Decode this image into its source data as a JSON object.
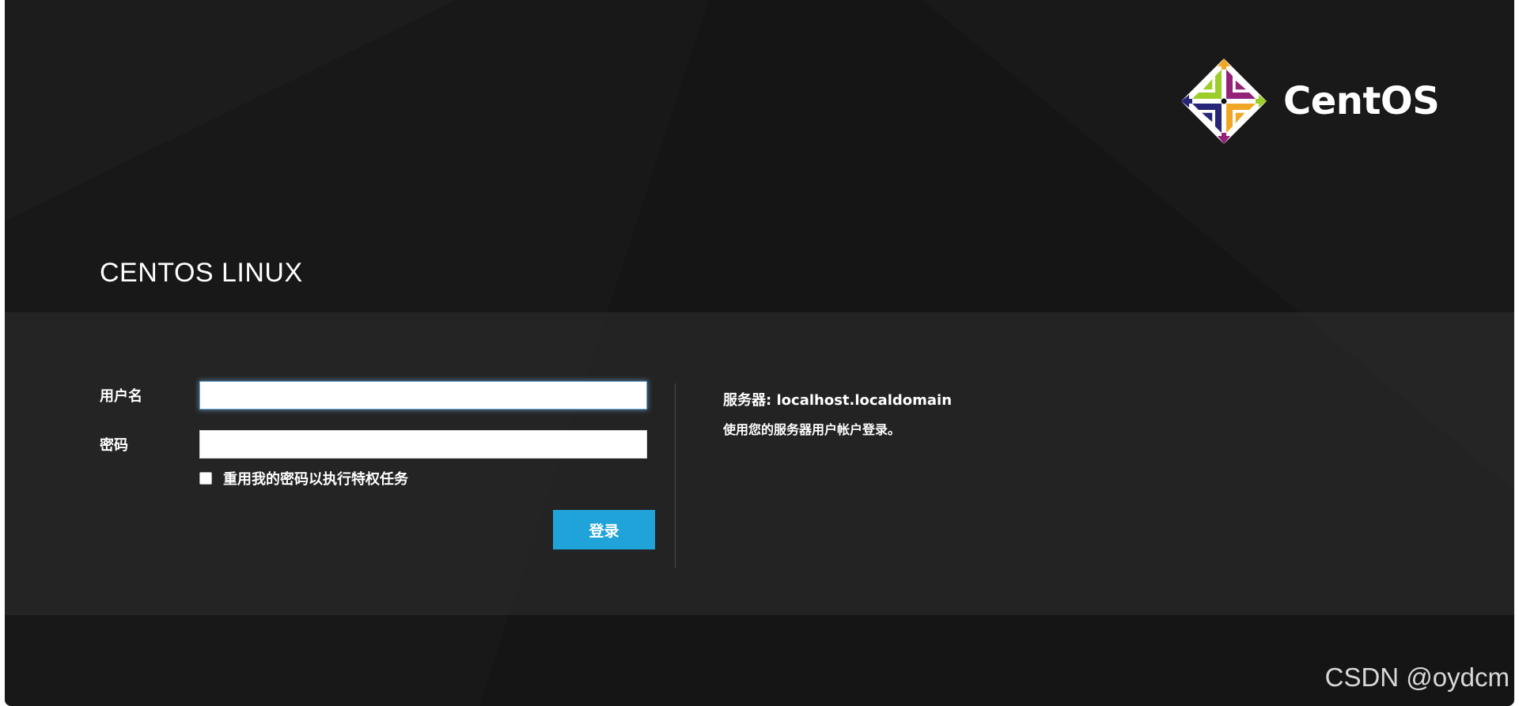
{
  "brand": {
    "title": "CENTOS LINUX",
    "logo_text": "CentOS",
    "logo_icon": "centos-pinwheel-icon"
  },
  "form": {
    "username_label": "用户名",
    "username_value": "",
    "password_label": "密码",
    "password_value": "",
    "reuse_password_label": "重用我的密码以执行特权任务",
    "reuse_password_checked": false,
    "login_button": "登录"
  },
  "server": {
    "label": "服务器:",
    "hostname": "localhost.localdomain",
    "hint": "使用您的服务器用户帐户登录。"
  },
  "watermark": "CSDN @oydcm",
  "colors": {
    "background": "#161616",
    "band": "#242424",
    "accent": "#1fa3d9",
    "logo_green": "#9ccd2a",
    "logo_purple": "#932279",
    "logo_orange": "#efa724",
    "logo_navy": "#262577"
  }
}
